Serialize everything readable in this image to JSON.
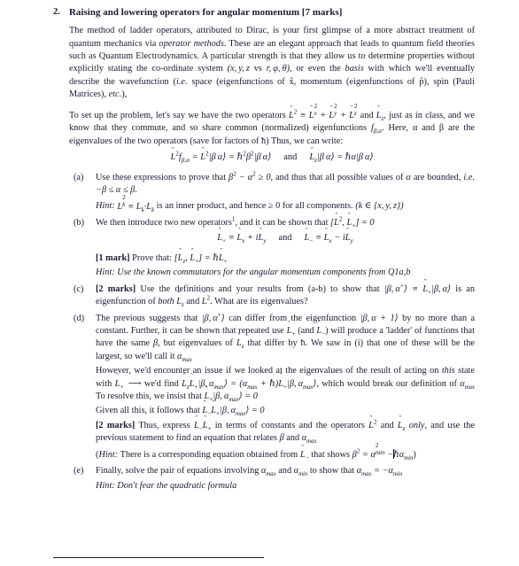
{
  "document": {
    "problem_number": "2.",
    "title": "Raising and lowering operators for angular momentum [7 marks]",
    "intro_paragraph_1": "The method of ladder operators, attributed to Dirac, is your first glimpse of a more abstract treatment of quantum mechanics via ",
    "intro_italic_1": "operator methods",
    "intro_paragraph_1b": ". These are an elegant approach that leads to quantum field theories such as Quantum Electrodynamics. A particular strength is that they allow us to determine properties without explicitly stating the co-ordinate system ",
    "intro_math_coords": "(x, y, z vs r, ϕ, θ)",
    "intro_paragraph_1c": ", or even the ",
    "intro_italic_2": "basis",
    "intro_paragraph_1d": " with which we'll eventually describe the wavefunction (",
    "intro_italic_3": "i.e.",
    "intro_paragraph_1e": " space (eigenfunctions of x̂, momentum (eigenfunctions of p̂), spin (Pauli Matrices), ",
    "intro_italic_4": "etc.",
    "intro_paragraph_1f": "),",
    "intro_paragraph_2a": "To set up the problem, let's say we have the two operators ",
    "intro_math_L2def": "L̂2 ≡ L̂x2 + L̂y2 + L̂z2",
    "intro_paragraph_2b": " and ",
    "intro_math_Lz": "L̂z",
    "intro_paragraph_2c": ", just as in class, and we know that they commute, and so share common (normalized) eigenfunctions ",
    "intro_math_f": "fβ,α",
    "intro_paragraph_2d": ". Here, α and β are the eigenvalues of the two operators (save for factors of ħ) Thus, we can write:",
    "display_equation_1_left": "L̂2 fβ,α = L̂2|β α⟩ = ħ²β²|β α⟩",
    "display_equation_1_conj": "and",
    "display_equation_1_right": "L̂z|β α⟩ = ħα|β α⟩"
  },
  "subitems": [
    {
      "label": "(a)",
      "text_a": "Use these expressions to prove that ",
      "math_1": "β² − α² ≥ 0",
      "text_b": ", and thus that all possible values of ",
      "math_2": "α",
      "text_c": " are bounded, ",
      "italic_ie": "i.e.",
      "math_3": "−β ≤ α ≤ β",
      "text_d": ".",
      "hint_label": "Hint:",
      "hint_math_1": "Lk² ≡ Lk · Lk",
      "hint_text_1": " is an inner product, and hence ≥ 0 for all components. ",
      "hint_math_2": "(k ∈ {x, y, z})"
    },
    {
      "label": "(b)",
      "text_a": "We then introduce two new operators",
      "footnote_marker": "1",
      "text_b": ", and it can be shown that ",
      "math_1": "[L̂2, L̂+] = 0",
      "display_left": "L̂+ ≡ L̂x + iL̂y",
      "display_conj": "and",
      "display_right": "L̂− ≡ L̂x − iL̂y",
      "marks": "[1 mark]",
      "prove_text": " Prove that: ",
      "prove_math": "[L̂z, L̂+] = ħL̂+",
      "hint": "Hint: Use the known commutators for the angular momentum components from Q1a,b"
    },
    {
      "label": "(c)",
      "marks": "[2 marks]",
      "text_a": " Use the definitions and your results from (a-b) to show that ",
      "math_1": "|β, α⁺⟩ ≡ L̂+|β, α⟩",
      "text_b": " is an eigenfunction of ",
      "italic_both": "both",
      "math_2": "L̂z",
      "text_c": " and ",
      "math_3": "L̂2",
      "text_d": ". What are its eigenvalues?"
    },
    {
      "label": "(d)",
      "p1_a": "The previous suggests that ",
      "p1_math_1": "|β, α⁺⟩",
      "p1_b": " can differ from the eigenfunction ",
      "p1_math_2": "|β, α + 1⟩",
      "p1_c": " by no more than a constant. Further, it can be shown that repeated use ",
      "p1_math_3": "L̂+",
      "p1_d": " (and ",
      "p1_math_4": "L̂−",
      "p1_e": ") will produce a 'ladder' of functions that have the same ",
      "p1_math_5": "β",
      "p1_f": ", but eigenvalues of ",
      "p1_math_6": "L̂z",
      "p1_g": " that differ by ħ. We saw in (i) that one of these will be the largest, so we'll call it ",
      "p1_math_7": "αmax",
      "p2_a": "However, we'd encounter an issue if we looked at the eigenvalues of the result of acting on ",
      "p2_italic": "this",
      "p2_b": " state with ",
      "p2_math_1": "L̂+ ⟶",
      "p2_c": " we'd find ",
      "p2_math_2": "L̂zL̂+|β, αmax⟩ = (αmax + ħ)L̂+|β, αmax⟩",
      "p2_d": ", which would break our definition of ",
      "p2_math_3": "αmax",
      "p2_e": " To resolve this, we insist that ",
      "p2_math_4": "L̂+|β, αmax⟩ = 0",
      "p3_a": "Given all this, it follows that ",
      "p3_math": "L̂−L̂+|β, αmax⟩ = 0",
      "marks": "[2 marks]",
      "p4_a": " Thus, express ",
      "p4_math_1": "L̂−L̂+",
      "p4_b": " in terms of constants and the operators ",
      "p4_math_2": "L̂2",
      "p4_c": " and ",
      "p4_math_3": "L̂z",
      "p4_italic_only": "only",
      "p4_d": ", and use the previous statement to find an equation that relates ",
      "p4_math_4": "β",
      "p4_e": " and ",
      "p4_math_5": "αmax",
      "p5_open": "(",
      "p5_hint_label": "Hint:",
      "p5_a": " There is a corresponding equation obtained from ",
      "p5_math_1": "L̂−",
      "p5_b": " that shows ",
      "p5_math_2": "β² = α²min − ħαmin",
      "p5_close": ")"
    },
    {
      "label": "(e)",
      "text_a": "Finally, solve the pair of equations involving ",
      "math_1": "αmax",
      "text_b": " and ",
      "math_2": "αmin",
      "text_c": " to show that ",
      "math_3": "αmax = −αmin",
      "hint": "Hint: Don't fear the quadratic formula"
    }
  ],
  "colors": {
    "text": "#1a1a2e",
    "background": "#ffffff",
    "rule": "#1a1a2e",
    "caret": "#111111"
  }
}
